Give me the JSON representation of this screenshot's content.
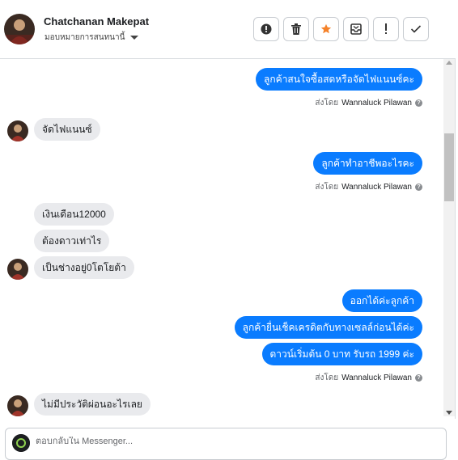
{
  "header": {
    "contact_name": "Chatchanan Makepat",
    "assign_label": "มอบหมายการสนทนานี้",
    "actions": [
      {
        "name": "report-button",
        "icon": "alert-circle-icon"
      },
      {
        "name": "delete-button",
        "icon": "trash-icon"
      },
      {
        "name": "star-button",
        "icon": "star-icon"
      },
      {
        "name": "archive-button",
        "icon": "archive-icon"
      },
      {
        "name": "mark-spam-button",
        "icon": "exclamation-icon"
      },
      {
        "name": "mark-done-button",
        "icon": "check-icon"
      }
    ]
  },
  "messages": {
    "m1": "ลูกค้าสนใจซื้อสดหรือจัดไฟแนนซ์คะ",
    "m2": "จัดไฟแนนซ์",
    "m3": "ลูกค้าทำอาชีพอะไรคะ",
    "m4": "เงินเดือน12000",
    "m5": "ต้องดาวเท่าไร",
    "m6": "เป็นช่างอยู่0โตโยต้า",
    "m7": "ออกได้ค่ะลูกค้า",
    "m8": "ลูกค้ายื่นเช็คเครดิตกับทางเซลล์ก่อนได้ค่ะ",
    "m9": "ดาวน์เริ่มต้น 0 บาท รับรถ 1999 ค่ะ",
    "m10": "ไม่มีประวัติผ่อนอะไรเลย"
  },
  "sent_by": {
    "prefix": "ส่งโดย",
    "agent": "Wannaluck Pilawan"
  },
  "reply": {
    "placeholder": "ตอบกลับใน Messenger..."
  },
  "colors": {
    "outgoing_bubble": "#0a7cff",
    "incoming_bubble": "#e9eaed",
    "star": "#f5822a"
  }
}
